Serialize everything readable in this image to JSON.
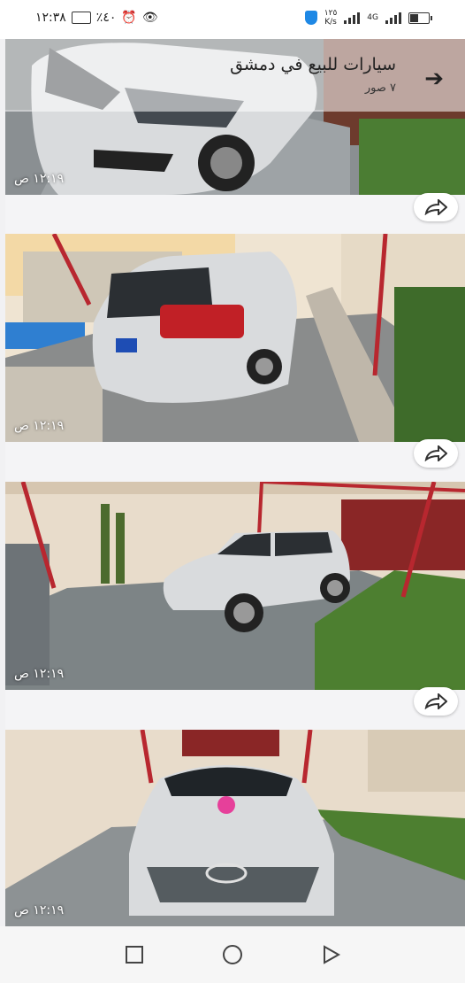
{
  "status_bar": {
    "time": "١٢:٣٨",
    "battery_percent": "٪٤٠",
    "speed_value": "١٢٥",
    "speed_unit": "K/s",
    "network": "4G"
  },
  "header": {
    "title": "سيارات للبيع في دمشق",
    "subtitle": "٧ صور"
  },
  "photos": [
    {
      "timestamp": "١٢:١٩ ص"
    },
    {
      "timestamp": "١٢:١٩ ص"
    },
    {
      "timestamp": "١٢:١٩ ص"
    },
    {
      "timestamp": "١٢:١٩ ص"
    }
  ],
  "colors": {
    "accent": "#1e88e5",
    "car": "#d9dbdd",
    "rail": "#b8272f",
    "wall": "#e8dccb"
  }
}
